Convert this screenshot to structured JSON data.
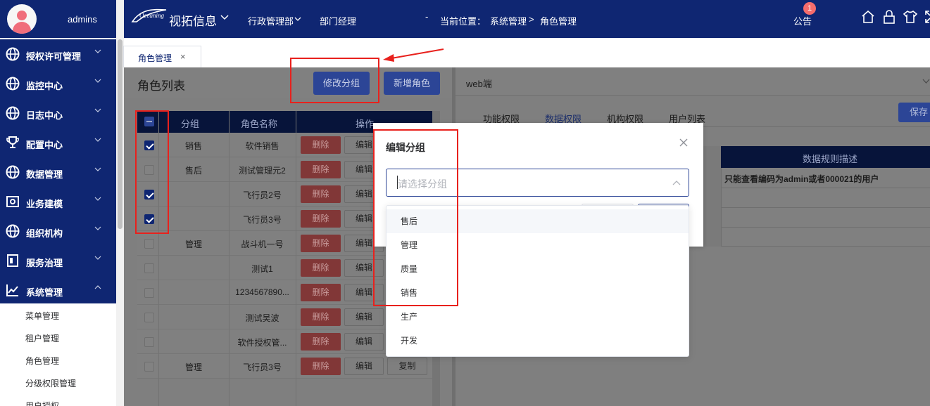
{
  "user": {
    "name": "admins"
  },
  "sidebar": {
    "items": [
      {
        "label": "授权许可管理",
        "icon": "globe-icon"
      },
      {
        "label": "监控中心",
        "icon": "globe-icon"
      },
      {
        "label": "日志中心",
        "icon": "globe-icon"
      },
      {
        "label": "配置中心",
        "icon": "trophy-icon"
      },
      {
        "label": "数据管理",
        "icon": "globe-icon"
      },
      {
        "label": "业务建模",
        "icon": "gear-box-icon"
      },
      {
        "label": "组织机构",
        "icon": "globe-icon"
      },
      {
        "label": "服务治理",
        "icon": "document-icon"
      },
      {
        "label": "系统管理",
        "icon": "chart-line-icon"
      }
    ],
    "sub_items": [
      "菜单管理",
      "租户管理",
      "角色管理",
      "分级权限管理",
      "用户授权"
    ]
  },
  "header": {
    "company": "视拓信息",
    "department": "行政管理部",
    "position": "部门经理",
    "dash": "-",
    "location_label": "当前位置：",
    "crumb_parent": "系统管理",
    "crumb_sep": ">",
    "crumb_current": "角色管理",
    "notice": "公告",
    "notice_count": "1"
  },
  "tabs": [
    {
      "label": "角色管理",
      "close": "×"
    }
  ],
  "role_panel": {
    "title": "角色列表",
    "edit_group_button": "修改分组",
    "new_role_button": "新增角色",
    "columns": [
      "分组",
      "角色名称",
      "操作"
    ],
    "rows": [
      {
        "group": "销售",
        "name": "软件销售",
        "checked": true
      },
      {
        "group": "售后",
        "name": "测试管理元2",
        "checked": false
      },
      {
        "group": "",
        "name": "飞行员2号",
        "checked": true
      },
      {
        "group": "",
        "name": "飞行员3号",
        "checked": true
      },
      {
        "group": "管理",
        "name": "战斗机一号",
        "checked": false
      },
      {
        "group": "",
        "name": "测试1",
        "checked": false
      },
      {
        "group": "",
        "name": "1234567890...",
        "checked": false
      },
      {
        "group": "",
        "name": "测试吴波",
        "checked": false
      },
      {
        "group": "",
        "name": "软件授权管...",
        "checked": false
      },
      {
        "group": "管理",
        "name": "飞行员3号",
        "checked": false
      }
    ],
    "delete_label": "删除",
    "edit_label": "编辑",
    "copy_label": "复制"
  },
  "right_panel": {
    "platform": "web端",
    "tabs": [
      "功能权限",
      "数据权限",
      "机构权限",
      "用户列表"
    ],
    "active_tab": "数据权限",
    "save_button": "保存",
    "column": "数据规则描述",
    "rule_desc": "只能查看编码为admin或者000021的用户"
  },
  "dialog": {
    "title": "编辑分组",
    "placeholder": "请选择分组",
    "options": [
      "售后",
      "管理",
      "质量",
      "销售",
      "生产",
      "开发"
    ]
  },
  "colors": {
    "primary": "#0f2672",
    "accent": "#2c4596",
    "annotation": "#e8211d",
    "danger": "#f56c6c"
  }
}
